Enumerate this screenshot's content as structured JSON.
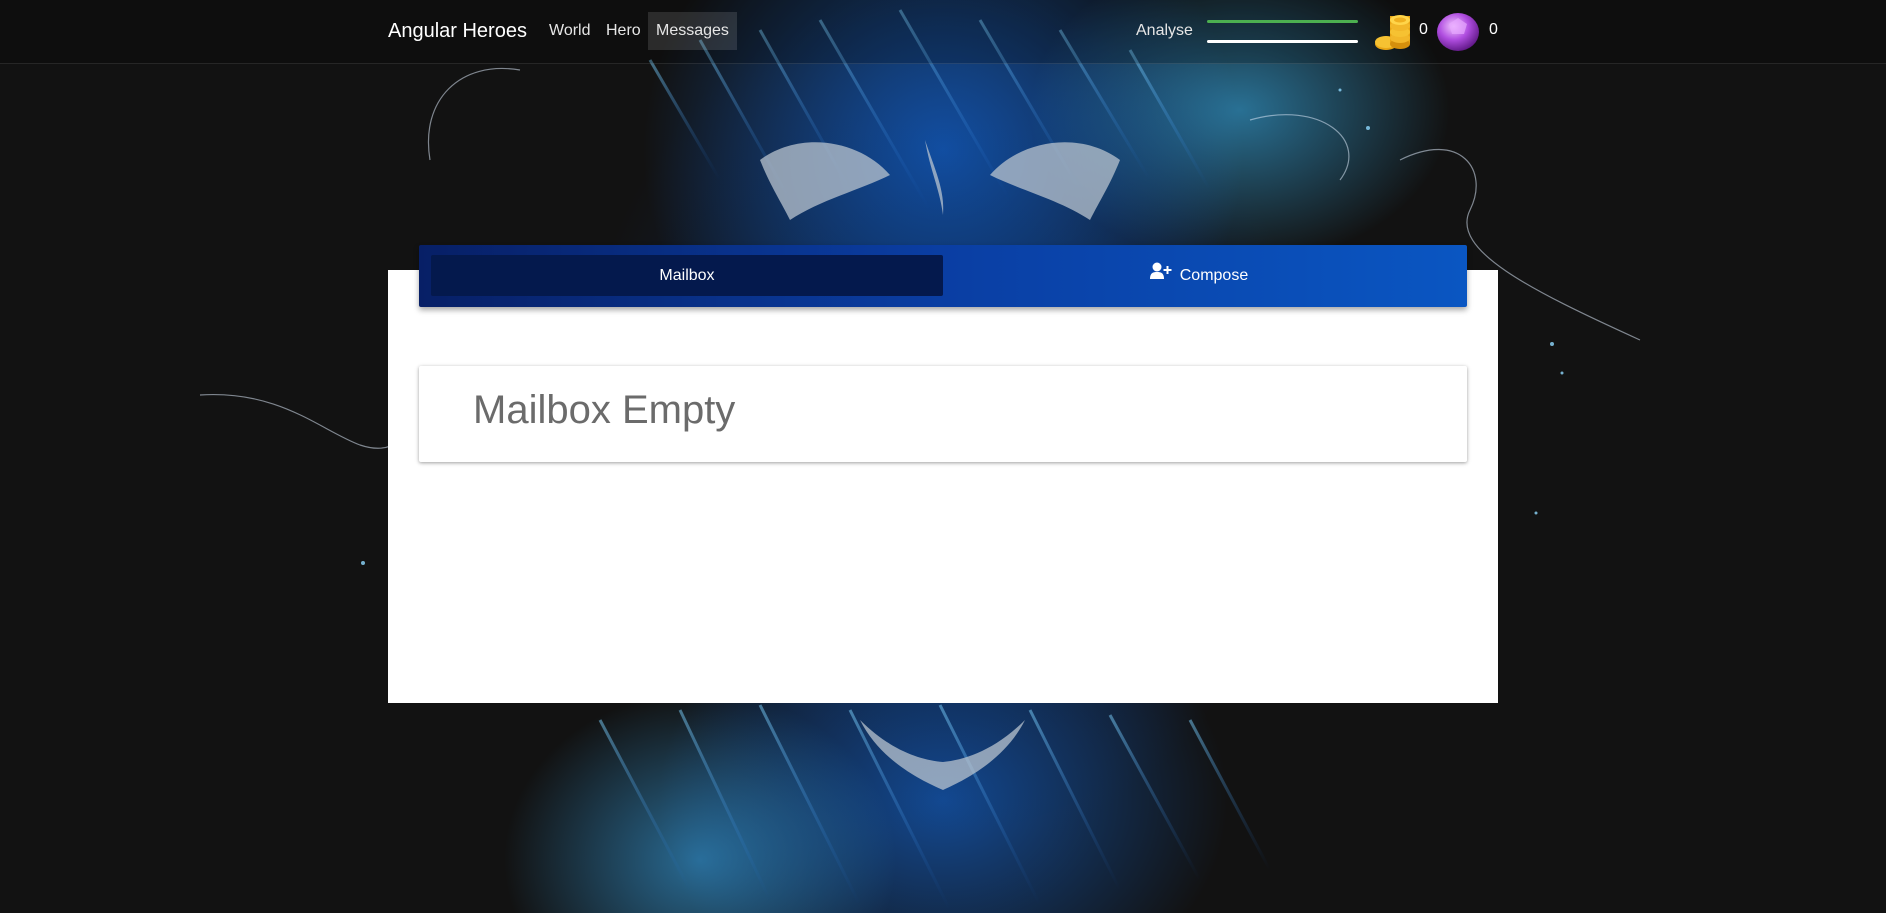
{
  "app": {
    "brand": "Angular Heroes"
  },
  "nav": {
    "items": [
      {
        "label": "World"
      },
      {
        "label": "Hero"
      },
      {
        "label": "Messages",
        "active": true
      }
    ],
    "analyse_label": "Analyse"
  },
  "stats": {
    "health_fraction": 1.0,
    "experience_fraction": 1.0,
    "health_color": "#4caf50",
    "experience_color": "#ffffff",
    "coins": "0",
    "gems": "0",
    "coin_icon": "coin-stack-icon",
    "gem_icon": "purple-gem-icon"
  },
  "messages": {
    "tabs": [
      {
        "label": "Mailbox",
        "active": true
      },
      {
        "label": "Compose",
        "icon": "user-plus-icon"
      }
    ],
    "empty_title": "Mailbox Empty"
  },
  "colors": {
    "tab_active": "#04194d",
    "tab_bar_start": "#071f66",
    "tab_bar_end": "#0a56c2"
  }
}
